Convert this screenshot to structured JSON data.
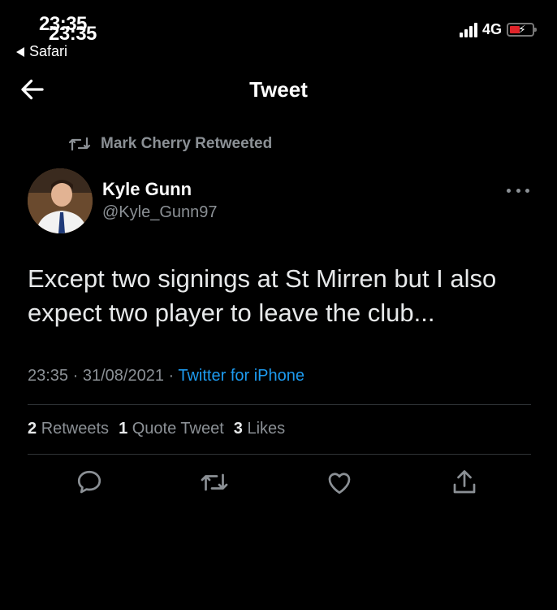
{
  "status_bar": {
    "time": "23:35",
    "back_app": "Safari",
    "network": "4G",
    "signal_levels": [
      0.35,
      0.55,
      0.75,
      1.0
    ],
    "battery_color": "#e0242a"
  },
  "header": {
    "title": "Tweet",
    "back_icon": "arrow-left-icon"
  },
  "tweet": {
    "retweeted_by": "Mark Cherry Retweeted",
    "author_name": "Kyle Gunn",
    "author_handle": "@Kyle_Gunn97",
    "text": "Except two signings at St Mirren but I also expect two player to leave the club...",
    "time": "23:35",
    "date": "31/08/2021",
    "source": "Twitter for iPhone",
    "stats": {
      "retweets_count": "2",
      "retweets_label": "Retweets",
      "quote_count": "1",
      "quote_label": "Quote Tweet",
      "likes_count": "3",
      "likes_label": "Likes"
    }
  },
  "actions": [
    "reply-icon",
    "retweet-icon",
    "like-icon",
    "share-icon"
  ],
  "colors": {
    "background": "#000000",
    "text": "#e7e9ea",
    "muted": "#8b9095",
    "link": "#1d9bf0",
    "divider": "#2f3336"
  }
}
